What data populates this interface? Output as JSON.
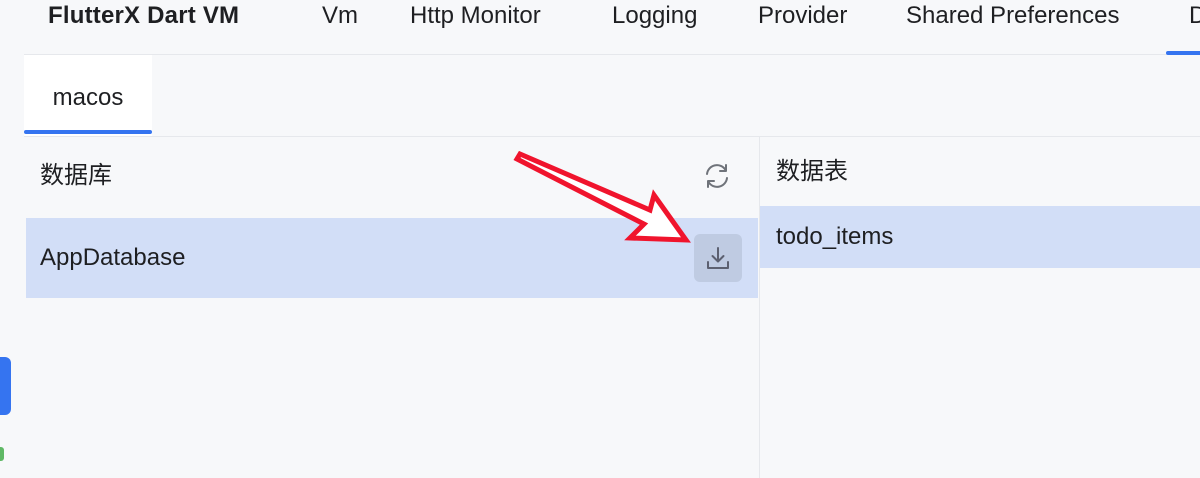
{
  "app": {
    "title": "FlutterX Dart VM"
  },
  "tabs": [
    {
      "label": "Vm"
    },
    {
      "label": "Http Monitor"
    },
    {
      "label": "Logging"
    },
    {
      "label": "Provider"
    },
    {
      "label": "Shared Preferences"
    },
    {
      "label": "D"
    }
  ],
  "sub_tabs": [
    {
      "label": "macos",
      "selected": true
    }
  ],
  "database_panel": {
    "title": "数据库",
    "refresh_icon": "refresh-icon",
    "items": [
      {
        "label": "AppDatabase",
        "selected": true,
        "action_icon": "download-icon"
      }
    ]
  },
  "tables_panel": {
    "title": "数据表",
    "items": [
      {
        "label": "todo_items",
        "selected": true
      }
    ]
  },
  "annotation": {
    "type": "arrow",
    "color": "#f0142d",
    "points_to": "download-icon"
  },
  "colors": {
    "accent": "#3574f0",
    "selection": "#d2def7",
    "download_button_bg": "#bfcbe2",
    "background": "#f7f8fa",
    "border": "#e6e8ec",
    "status_green": "#5fb865"
  }
}
